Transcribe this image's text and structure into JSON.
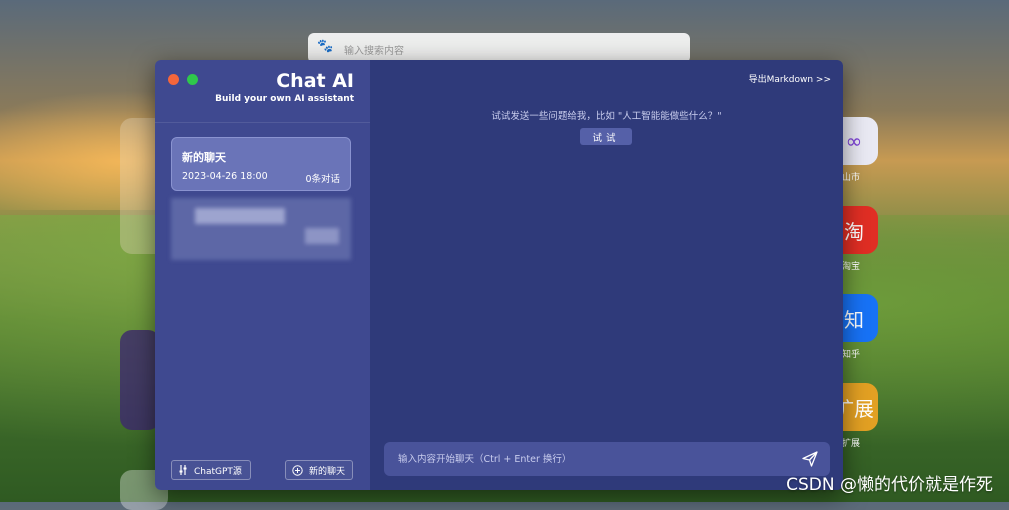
{
  "background": {
    "search_placeholder": "输入搜索内容",
    "apps": [
      {
        "glyph": "∞",
        "label": "山市",
        "color": "#e9e9f3"
      },
      {
        "glyph": "淘",
        "label": "淘宝",
        "color": "#e02e24"
      },
      {
        "glyph": "知",
        "label": "知乎",
        "color": "#1772f6"
      },
      {
        "glyph": "扩展",
        "label": "扩展",
        "color": "#e2a023"
      }
    ]
  },
  "window": {
    "brand_title": "Chat AI",
    "brand_subtitle": "Build your own AI assistant",
    "export_label": "导出Markdown >>",
    "chats": [
      {
        "title": "新的聊天",
        "date": "2023-04-26 18:00",
        "count": "0条对话"
      }
    ],
    "gpt_button": "ChatGPT源",
    "new_chat_button": "新的聊天",
    "hint": "试试发送一些问题给我，比如 \"人工智能能做些什么？\"",
    "try_button": "试试",
    "input_placeholder": "输入内容开始聊天（Ctrl + Enter 换行）"
  },
  "watermark": "CSDN @懒的代价就是作死",
  "colors": {
    "sidebar": "#3f4990",
    "main": "#2f3a7a",
    "accent": "#5560a8",
    "close_dot": "#f4663b",
    "max_dot": "#2fc84b"
  }
}
